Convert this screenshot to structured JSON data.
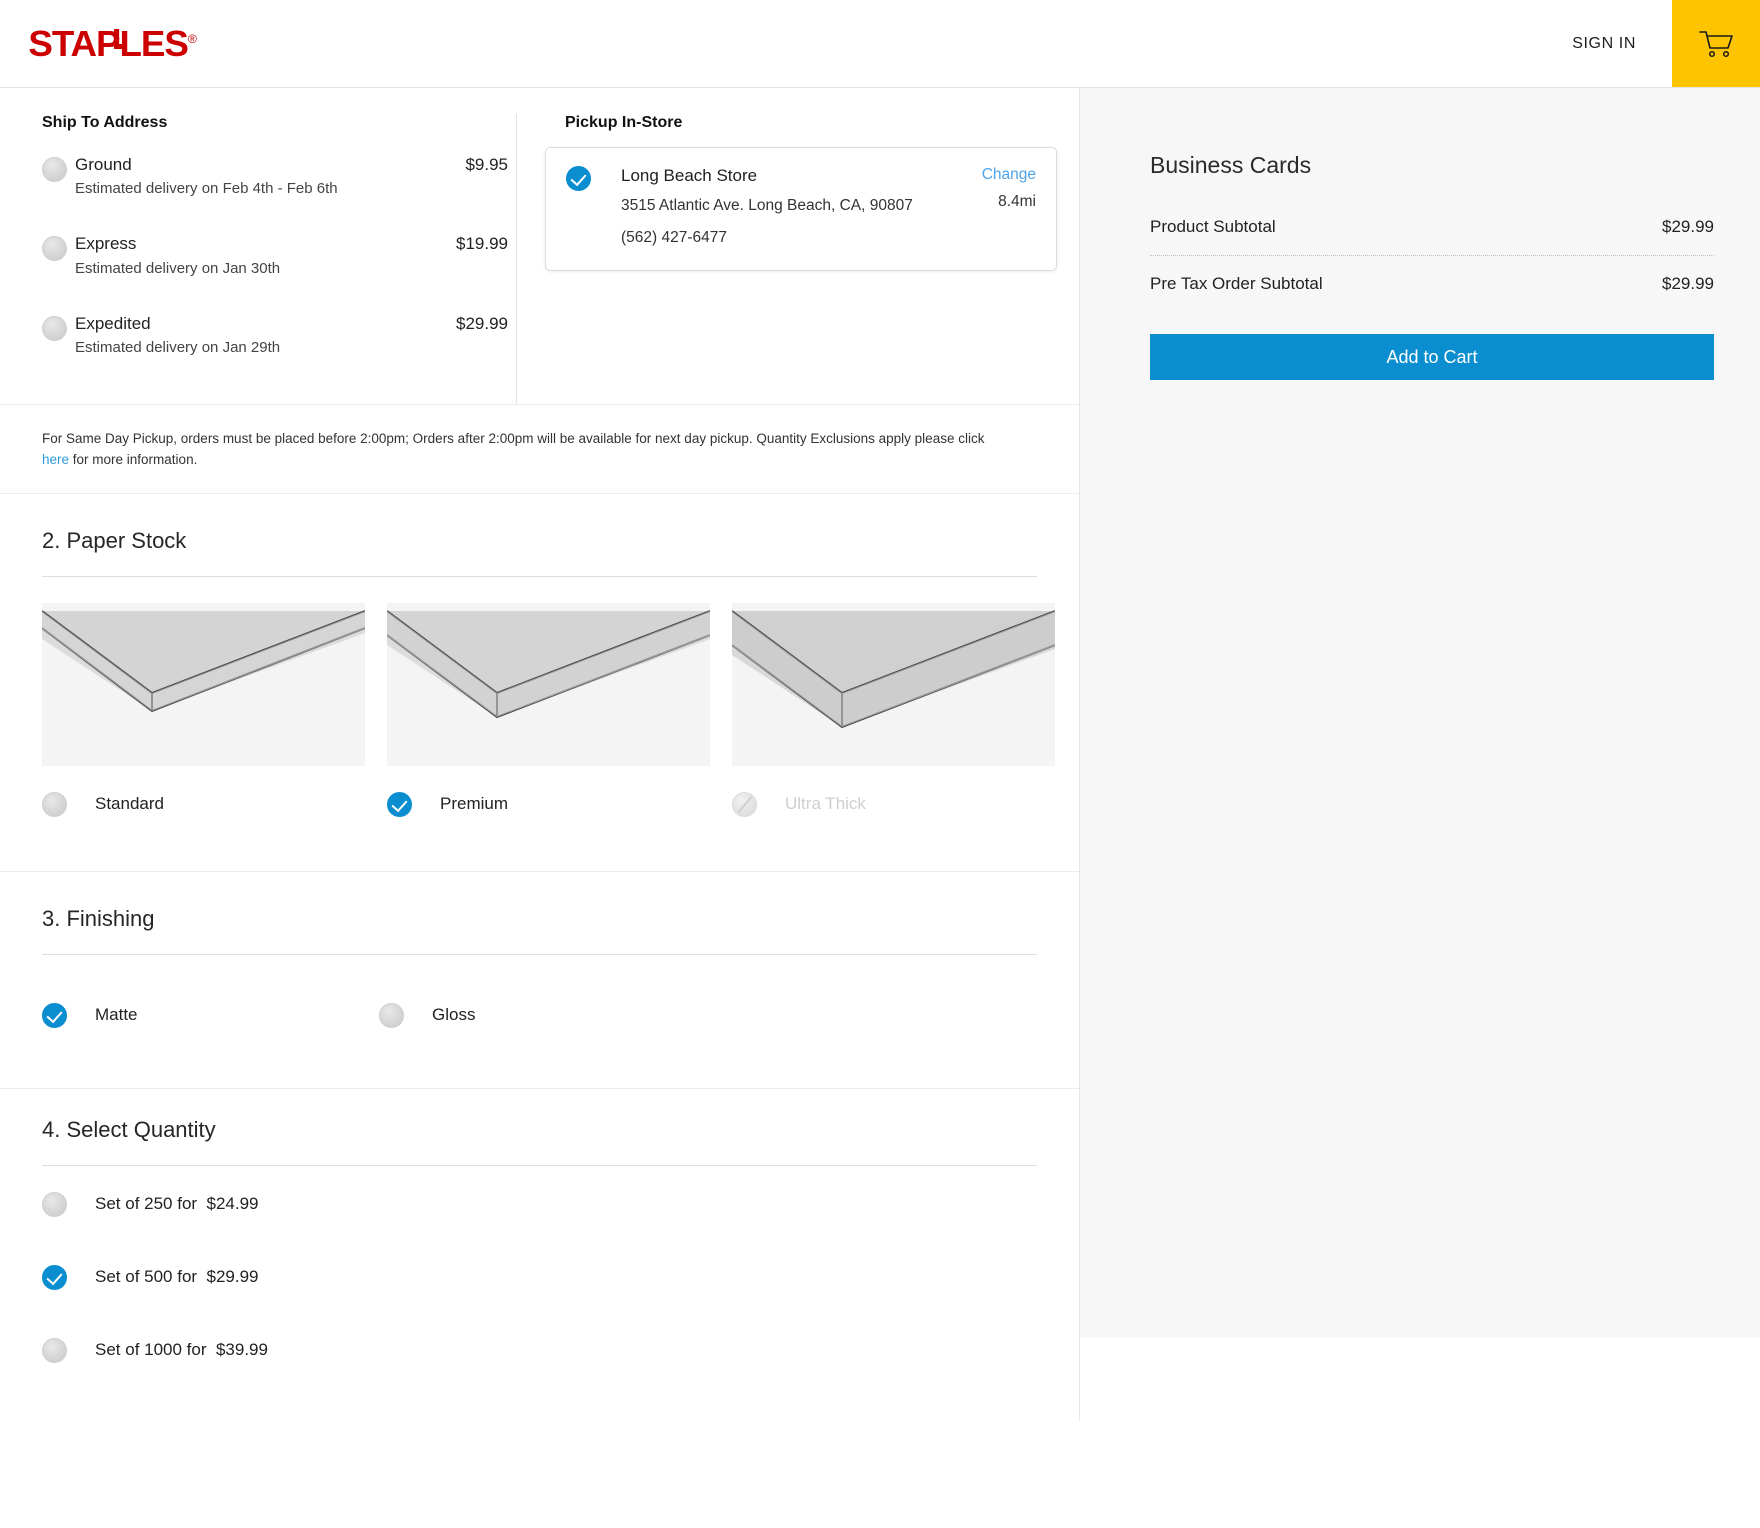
{
  "header": {
    "logo_text": "STAPLES",
    "logo_registered": "®",
    "signin_label": "SIGN IN",
    "cart_icon": "shopping-cart-icon",
    "cart_color": "#ffc400",
    "logo_color": "#cc0000"
  },
  "shipping": {
    "heading": "Ship To Address",
    "options": [
      {
        "name": "Ground",
        "eta": "Estimated delivery on Feb 4th - Feb 6th",
        "price": "$9.95",
        "selected": false
      },
      {
        "name": "Express",
        "eta": "Estimated delivery on Jan 30th",
        "price": "$19.99",
        "selected": false
      },
      {
        "name": "Expedited",
        "eta": "Estimated delivery on Jan 29th",
        "price": "$29.99",
        "selected": false
      }
    ]
  },
  "pickup": {
    "heading": "Pickup In-Store",
    "store_name": "Long Beach Store",
    "store_address": "3515 Atlantic Ave. Long Beach, CA, 90807",
    "store_phone": "(562) 427-6477",
    "change_label": "Change",
    "distance": "8.4mi",
    "selected": true
  },
  "disclaimer": {
    "text_before": "For Same Day Pickup, orders must be placed before 2:00pm; Orders after 2:00pm will be available for next day pickup. Quantity Exclusions apply please click ",
    "link_label": "here",
    "text_after": " for more information."
  },
  "paper_stock": {
    "title": "2. Paper Stock",
    "options": [
      {
        "label": "Standard",
        "selected": false,
        "disabled": false
      },
      {
        "label": "Premium",
        "selected": true,
        "disabled": false
      },
      {
        "label": "Ultra Thick",
        "selected": false,
        "disabled": true
      }
    ]
  },
  "finishing": {
    "title": "3. Finishing",
    "options": [
      {
        "label": "Matte",
        "selected": true
      },
      {
        "label": "Gloss",
        "selected": false
      }
    ]
  },
  "quantity": {
    "title": "4. Select Quantity",
    "options": [
      {
        "label": "Set of 250 for  $24.99",
        "selected": false
      },
      {
        "label": "Set of 500 for  $29.99",
        "selected": true
      },
      {
        "label": "Set of 1000 for  $39.99",
        "selected": false
      }
    ]
  },
  "summary": {
    "title": "Business Cards",
    "rows": [
      {
        "label": "Product Subtotal",
        "value": "$29.99"
      },
      {
        "label": "Pre Tax Order Subtotal",
        "value": "$29.99"
      }
    ],
    "add_to_cart_label": "Add to Cart",
    "accent_color": "#0a8ed0"
  }
}
